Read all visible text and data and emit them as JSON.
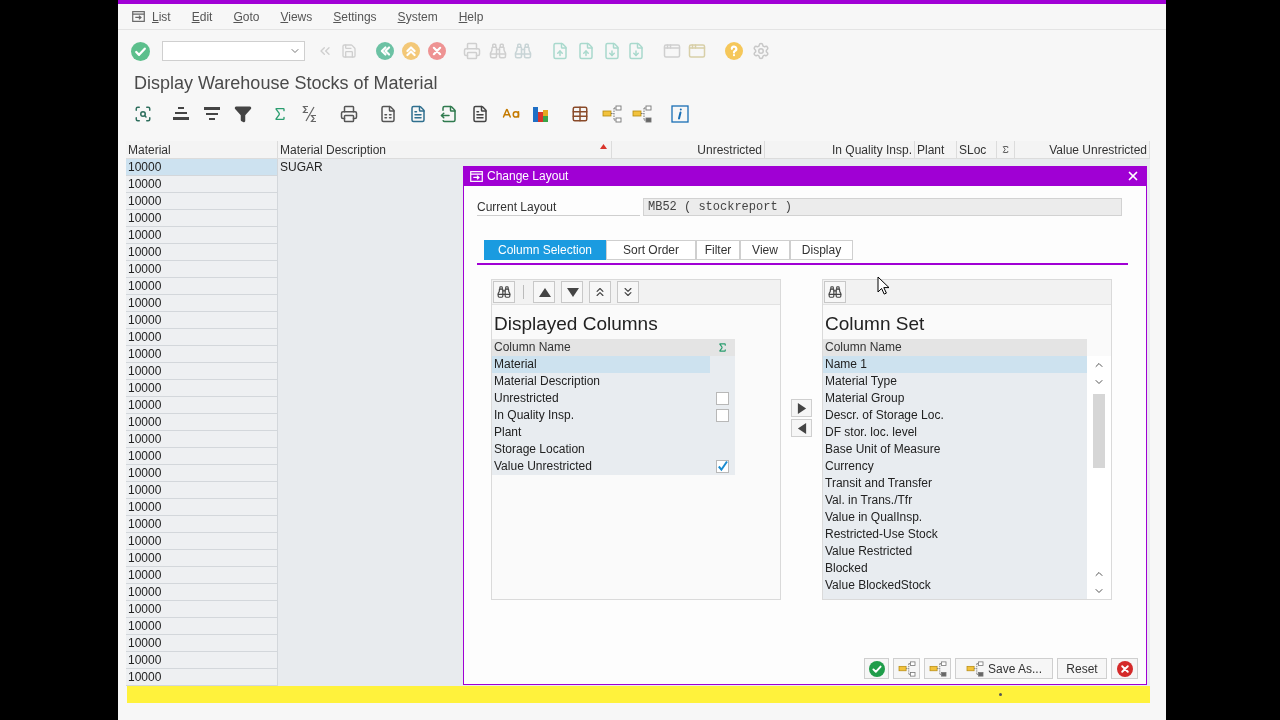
{
  "window": {
    "menu": [
      {
        "label": "List"
      },
      {
        "label": "Edit"
      },
      {
        "label": "Goto"
      },
      {
        "label": "Views"
      },
      {
        "label": "Settings"
      },
      {
        "label": "System"
      },
      {
        "label": "Help"
      }
    ],
    "title": "Display Warehouse Stocks of Material"
  },
  "grid": {
    "columns": [
      {
        "label": "Material",
        "kind": "text",
        "sorted": false
      },
      {
        "label": "Material Description",
        "kind": "text",
        "sorted": true
      },
      {
        "label": "Unrestricted",
        "kind": "number",
        "sorted": false
      },
      {
        "label": "In Quality Insp.",
        "kind": "number",
        "sorted": false
      },
      {
        "label": "Plant",
        "kind": "text",
        "sorted": false
      },
      {
        "label": "SLoc",
        "kind": "text",
        "sorted": false
      },
      {
        "kind": "sum",
        "sorted": false
      },
      {
        "label": "Value Unrestricted",
        "kind": "number",
        "sorted": false
      }
    ],
    "rows": [
      {
        "material": "10000",
        "description": "SUGAR",
        "selected": true
      },
      {
        "material": "10000",
        "selected": false
      },
      {
        "material": "10000",
        "selected": false
      },
      {
        "material": "10000",
        "selected": false
      },
      {
        "material": "10000",
        "selected": false
      },
      {
        "material": "10000",
        "selected": false
      },
      {
        "material": "10000",
        "selected": false
      },
      {
        "material": "10000",
        "selected": false
      },
      {
        "material": "10000",
        "selected": false
      },
      {
        "material": "10000",
        "selected": false
      },
      {
        "material": "10000",
        "selected": false
      },
      {
        "material": "10000",
        "selected": false
      },
      {
        "material": "10000",
        "selected": false
      },
      {
        "material": "10000",
        "selected": false
      },
      {
        "material": "10000",
        "selected": false
      },
      {
        "material": "10000",
        "selected": false
      },
      {
        "material": "10000",
        "selected": false
      },
      {
        "material": "10000",
        "selected": false
      },
      {
        "material": "10000",
        "selected": false
      },
      {
        "material": "10000",
        "selected": false
      },
      {
        "material": "10000",
        "selected": false
      },
      {
        "material": "10000",
        "selected": false
      },
      {
        "material": "10000",
        "selected": false
      },
      {
        "material": "10000",
        "selected": false
      },
      {
        "material": "10000",
        "selected": false
      },
      {
        "material": "10000",
        "selected": false
      },
      {
        "material": "10000",
        "selected": false
      },
      {
        "material": "10000",
        "selected": false
      },
      {
        "material": "10000",
        "selected": false
      },
      {
        "material": "10000",
        "selected": false
      },
      {
        "material": "10000",
        "selected": false
      }
    ]
  },
  "dialog": {
    "title": "Change Layout",
    "current_layout": {
      "label": "Current Layout",
      "value": "MB52 ( stockreport )"
    },
    "tabs": [
      {
        "label": "Column Selection",
        "selected": true
      },
      {
        "label": "Sort Order",
        "selected": false
      },
      {
        "label": "Filter",
        "selected": false
      },
      {
        "label": "View",
        "selected": false
      },
      {
        "label": "Display",
        "selected": false
      }
    ],
    "displayed_columns": {
      "title": "Displayed Columns",
      "header": "Column Name",
      "rows": [
        {
          "name": "Material",
          "kind": "plain",
          "selected": true
        },
        {
          "name": "Material Description",
          "kind": "plain",
          "selected": false
        },
        {
          "name": "Unrestricted",
          "kind": "summable",
          "checked": false,
          "selected": false
        },
        {
          "name": "In Quality Insp.",
          "kind": "summable",
          "checked": false,
          "selected": false
        },
        {
          "name": "Plant",
          "kind": "plain",
          "selected": false
        },
        {
          "name": "Storage Location",
          "kind": "plain",
          "selected": false
        },
        {
          "name": "Value Unrestricted",
          "kind": "summable",
          "checked": true,
          "selected": false
        }
      ]
    },
    "column_set": {
      "title": "Column Set",
      "header": "Column Name",
      "rows": [
        {
          "name": "Name 1",
          "selected": true
        },
        {
          "name": "Material Type",
          "selected": false
        },
        {
          "name": "Material Group",
          "selected": false
        },
        {
          "name": "Descr. of Storage Loc.",
          "selected": false
        },
        {
          "name": "DF stor. loc. level",
          "selected": false
        },
        {
          "name": "Base Unit of Measure",
          "selected": false
        },
        {
          "name": "Currency",
          "selected": false
        },
        {
          "name": "Transit and Transfer",
          "selected": false
        },
        {
          "name": "Val. in Trans./Tfr",
          "selected": false
        },
        {
          "name": "Value in QualInsp.",
          "selected": false
        },
        {
          "name": "Restricted-Use Stock",
          "selected": false
        },
        {
          "name": "Value Restricted",
          "selected": false
        },
        {
          "name": "Blocked",
          "selected": false
        },
        {
          "name": "Value BlockedStock",
          "selected": false
        }
      ]
    },
    "buttons": [
      {
        "label": "Save As..."
      },
      {
        "label": "Reset"
      }
    ]
  }
}
